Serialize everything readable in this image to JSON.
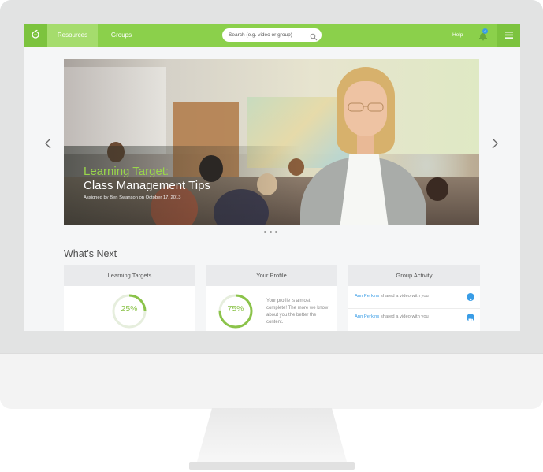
{
  "nav": {
    "logo_icon": "apple-logo-icon",
    "tabs": [
      {
        "label": "Resources",
        "active": true
      },
      {
        "label": "Groups",
        "active": false
      }
    ],
    "search_placeholder": "Search (e.g. video or group)",
    "help_label": "Help",
    "notification_count": "4",
    "accent_color": "#8bd04b"
  },
  "hero": {
    "title_line1": "Learning Target:",
    "title_line2": "Class Management Tips",
    "subtitle": "Assigned by Ben Swanson on October 17, 2013",
    "slide_count": 3,
    "active_slide": 1
  },
  "section_title": "What’s Next",
  "cards": {
    "learning_targets": {
      "title": "Learning Targets",
      "percent_label": "25%",
      "percent": 0.25
    },
    "profile": {
      "title": "Your Profile",
      "percent_label": "75%",
      "percent": 0.75,
      "text": "Your profile is almost complete! The more we know about you,the better the content."
    },
    "group_activity": {
      "title": "Group Activity",
      "items": [
        {
          "name": "Ann Perkins",
          "text": " shared a video with you"
        },
        {
          "name": "Ann Perkins",
          "text": " shared a video with you"
        }
      ]
    }
  }
}
